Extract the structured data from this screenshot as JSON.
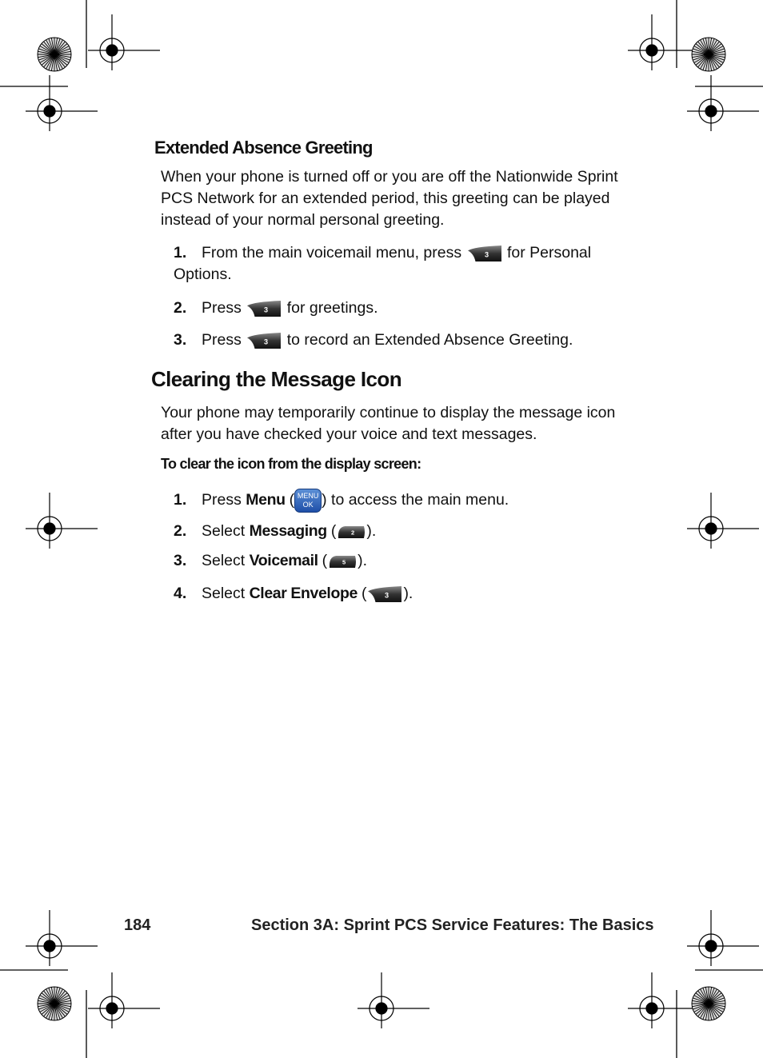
{
  "section1": {
    "heading": "Extended Absence Greeting",
    "intro": "When your phone is turned off or you are off the Nationwide Sprint PCS Network for an extended period, this greeting can be played instead of your normal personal greeting.",
    "steps": [
      {
        "num": "1.",
        "before": "From the main voicemail menu, press",
        "key": "3 DEF",
        "after": "for Personal Options."
      },
      {
        "num": "2.",
        "before": "Press",
        "key": "3 DEF",
        "after": "for greetings."
      },
      {
        "num": "3.",
        "before": "Press",
        "key": "3 DEF",
        "after": "to record an Extended Absence Greeting."
      }
    ]
  },
  "section2": {
    "heading": "Clearing the Message Icon",
    "intro": "Your phone may temporarily continue to display the message icon after you have checked your voice and text messages.",
    "subheading": "To clear the icon from the display screen:",
    "steps": [
      {
        "num": "1.",
        "before": "Press",
        "bold": "Menu",
        "key": "MENU OK",
        "after": ") to access the main menu."
      },
      {
        "num": "2.",
        "before": "Select",
        "bold": "Messaging",
        "key": "2 ABC",
        "after": ")."
      },
      {
        "num": "3.",
        "before": "Select",
        "bold": "Voicemail",
        "key": "5 JKL",
        "after": ")."
      },
      {
        "num": "4.",
        "before": "Select",
        "bold": "Clear Envelope",
        "key": "3 DEF",
        "after": ")."
      }
    ]
  },
  "keys": {
    "menu_line1": "MENU",
    "menu_line2": "OK",
    "three": "3",
    "two": "2",
    "five": "5"
  },
  "footer": {
    "page_number": "184",
    "section_title": "Section 3A: Sprint PCS Service Features: The Basics"
  }
}
